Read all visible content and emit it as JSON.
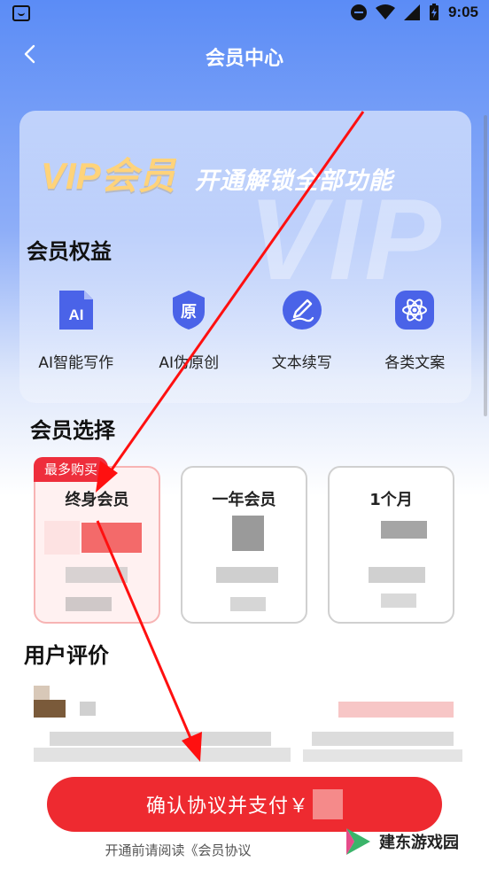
{
  "status": {
    "time": "9:05"
  },
  "header": {
    "title": "会员中心"
  },
  "banner": {
    "vip_text": "VIP会员",
    "slogan": "开通解锁全部功能",
    "watermark": "VIP"
  },
  "benefits": {
    "title": "会员权益",
    "items": [
      {
        "label": "AI智能写作",
        "icon_text": "AI",
        "icon": "ai-doc-icon"
      },
      {
        "label": "AI伪原创",
        "icon_text": "原",
        "icon": "shield-original-icon"
      },
      {
        "label": "文本续写",
        "icon": "pen-icon"
      },
      {
        "label": "各类文案",
        "icon": "atom-icon"
      }
    ]
  },
  "plans": {
    "title": "会员选择",
    "badge": "最多购买",
    "items": [
      {
        "name": "终身会员",
        "selected": true
      },
      {
        "name": "一年会员",
        "selected": false
      },
      {
        "name": "1个月",
        "selected": false
      }
    ]
  },
  "reviews": {
    "title": "用户评价"
  },
  "footer": {
    "pay_label": "确认协议并支付￥",
    "agreement_text": "开通前请阅读《会员协议",
    "watermark_site": "建东游戏园"
  },
  "colors": {
    "accent_red": "#ee2a30",
    "brand_blue": "#5b8cf6",
    "gold": "#ffd37a"
  }
}
